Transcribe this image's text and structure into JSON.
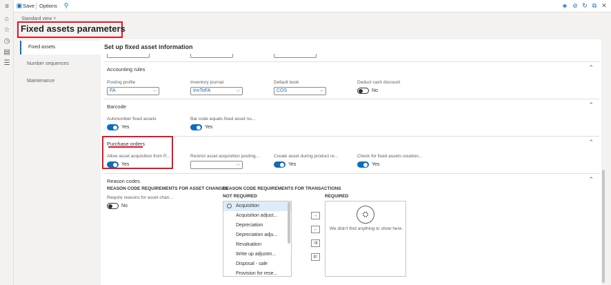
{
  "actionbar": {
    "save_label": "Save",
    "options_label": "Options"
  },
  "header": {
    "view_label": "Standard view ˅",
    "title": "Fixed assets parameters"
  },
  "tabs": [
    {
      "label": "Fixed assets"
    },
    {
      "label": "Number sequences"
    },
    {
      "label": "Maintenance"
    }
  ],
  "main": {
    "heading": "Set up fixed asset information"
  },
  "accounting": {
    "title": "Accounting rules",
    "posting_profile": {
      "label": "Posting profile",
      "value": "FA"
    },
    "inventory_journal": {
      "label": "Inventory journal",
      "value": "InvToFA"
    },
    "default_book": {
      "label": "Default book",
      "value": "COS"
    },
    "deduct_cash": {
      "label": "Deduct cash discount",
      "value": "No"
    }
  },
  "barcode": {
    "title": "Barcode",
    "autonumber": {
      "label": "Autonumber fixed assets",
      "value": "Yes"
    },
    "barcode_equals": {
      "label": "Bar code equals fixed asset nu...",
      "value": "Yes"
    }
  },
  "purchase": {
    "title": "Purchase orders",
    "allow": {
      "label": "Allow asset acquisition from P...",
      "value": "Yes"
    },
    "restrict": {
      "label": "Restrict asset acquisition posting...",
      "value": ""
    },
    "create": {
      "label": "Create asset during product re...",
      "value": "Yes"
    },
    "check": {
      "label": "Check for fixed assets creation...",
      "value": "Yes"
    }
  },
  "reason": {
    "title": "Reason codes",
    "changes_heading": "REASON CODE REQUIREMENTS FOR ASSET CHANGES",
    "transactions_heading": "REASON CODE REQUIREMENTS FOR TRANSACTIONS",
    "require": {
      "label": "Require reasons for asset chan...",
      "value": "No"
    },
    "not_required_label": "NOT REQUIRED",
    "required_label": "REQUIRED",
    "not_required_items": [
      "Acquisition",
      "Acquisition adjust...",
      "Depreciation",
      "Depreciation adju...",
      "Revaluation",
      "Write up adjustm...",
      "Disposal - sale",
      "Provision for rese..."
    ],
    "move_buttons": [
      "→",
      "←",
      "⇉",
      "⇇"
    ],
    "empty_text": "We didn't find anything to show here."
  }
}
